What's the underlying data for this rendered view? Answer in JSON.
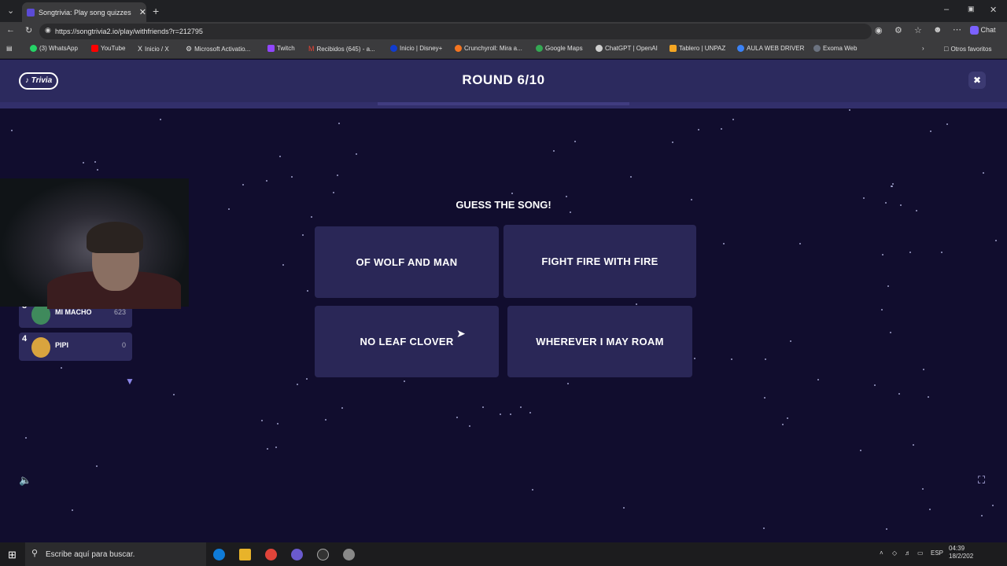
{
  "browser": {
    "tab_title": "Songtrivia: Play song quizzes with",
    "url": "https://songtrivia2.io/play/withfriends?r=212795",
    "bookmarks": [
      "(3) WhatsApp",
      "YouTube",
      "Inicio / X",
      "Microsoft Activatio...",
      "Twitch",
      "Recibidos (645) - a...",
      "Inicio | Disney+",
      "Crunchyroll: Mira a...",
      "Google Maps",
      "ChatGPT | OpenAI",
      "Tablero | UNPAZ",
      "AULA WEB DRIVER",
      "Exoma Web"
    ],
    "other_bookmarks": "Otros favoritos",
    "chat_label": "Chat"
  },
  "game": {
    "logo_text": "Song Trivia",
    "round": "ROUND 6/10",
    "prompt": "GUESS THE SONG!",
    "options": [
      "OF WOLF AND MAN",
      "FIGHT FIRE WITH FIRE",
      "NO LEAF CLOVER",
      "WHEREVER I MAY ROAM"
    ],
    "players": [
      {
        "rank": "3",
        "name": "MI MACHO",
        "score": "623"
      },
      {
        "rank": "4",
        "name": "PIPI",
        "score": "0"
      }
    ]
  },
  "taskbar": {
    "search_placeholder": "Escribe aquí para buscar.",
    "lang": "ESP",
    "time": "04:39",
    "date": "18/2/202"
  },
  "colors": {
    "background": "#110d2e",
    "header": "#2c2a5e",
    "option": "#2a2757"
  },
  "icons": [
    "back-icon",
    "refresh-icon",
    "lock-icon",
    "close-icon",
    "volume-icon",
    "fullscreen-icon",
    "chevron-down-icon",
    "windows-icon",
    "search-icon"
  ]
}
